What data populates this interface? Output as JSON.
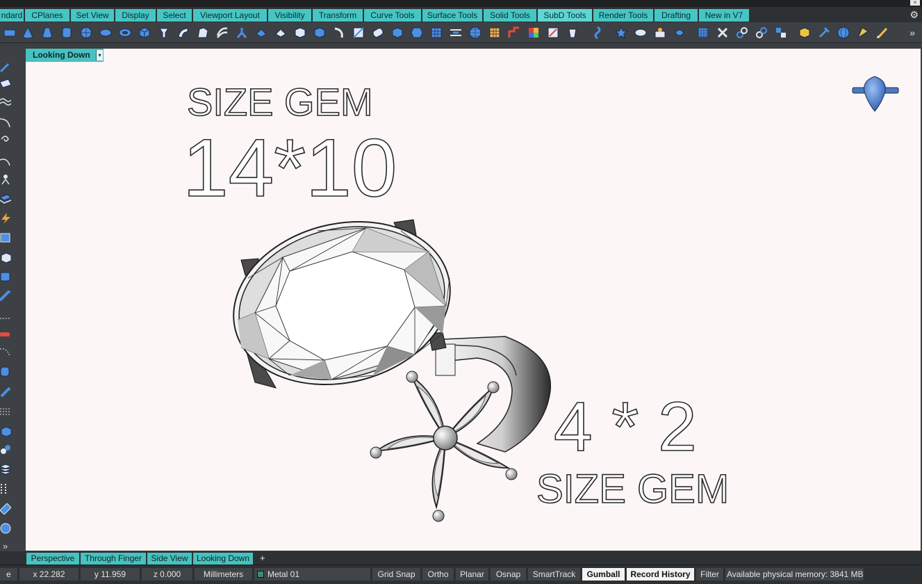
{
  "tabs": [
    {
      "label": "ndard"
    },
    {
      "label": "CPlanes"
    },
    {
      "label": "Set View"
    },
    {
      "label": "Display"
    },
    {
      "label": "Select"
    },
    {
      "label": "Viewport Layout"
    },
    {
      "label": "Visibility"
    },
    {
      "label": "Transform"
    },
    {
      "label": "Curve Tools"
    },
    {
      "label": "Surface Tools"
    },
    {
      "label": "Solid Tools"
    },
    {
      "label": "SubD Tools"
    },
    {
      "label": "Render Tools"
    },
    {
      "label": "Drafting"
    },
    {
      "label": "New in V7"
    }
  ],
  "active_tab": "SubD Tools",
  "toolbar": {
    "more_label": "»"
  },
  "corner_close": "×",
  "settings_icon": "⚙",
  "viewport": {
    "title": "Looking Down",
    "dropdown_arrow": "▾",
    "texts": {
      "size_gem_1": "SIZE GEM",
      "dim_1": "14*10",
      "dim_2": "4 * 2",
      "size_gem_2": "SIZE GEM"
    }
  },
  "view_tabs": [
    {
      "label": "Perspective"
    },
    {
      "label": "Through Finger"
    },
    {
      "label": "Side View"
    },
    {
      "label": "Looking Down"
    }
  ],
  "add_view_tab": "+",
  "left_more": "»",
  "status": {
    "command": "e",
    "x": "x 22.282",
    "y": "y 11.959",
    "z": "z 0.000",
    "units": "Millimeters",
    "layer": "Metal 01",
    "grid_snap": "Grid Snap",
    "ortho": "Ortho",
    "planar": "Planar",
    "osnap": "Osnap",
    "smarttrack": "SmartTrack",
    "gumball": "Gumball",
    "record_history": "Record History",
    "filter": "Filter",
    "memory": "Available physical memory: 3841 MB"
  },
  "colors": {
    "tab_accent": "#45c6c4",
    "viewport_bg": "#fdf6f6",
    "layer_color": "#3c8c6e",
    "toolbar_icon": "#4a86d9"
  },
  "icons": [
    "close-icon",
    "gear-icon",
    "chevron-right-icon",
    "dropdown-arrow-icon",
    "plus-icon"
  ]
}
